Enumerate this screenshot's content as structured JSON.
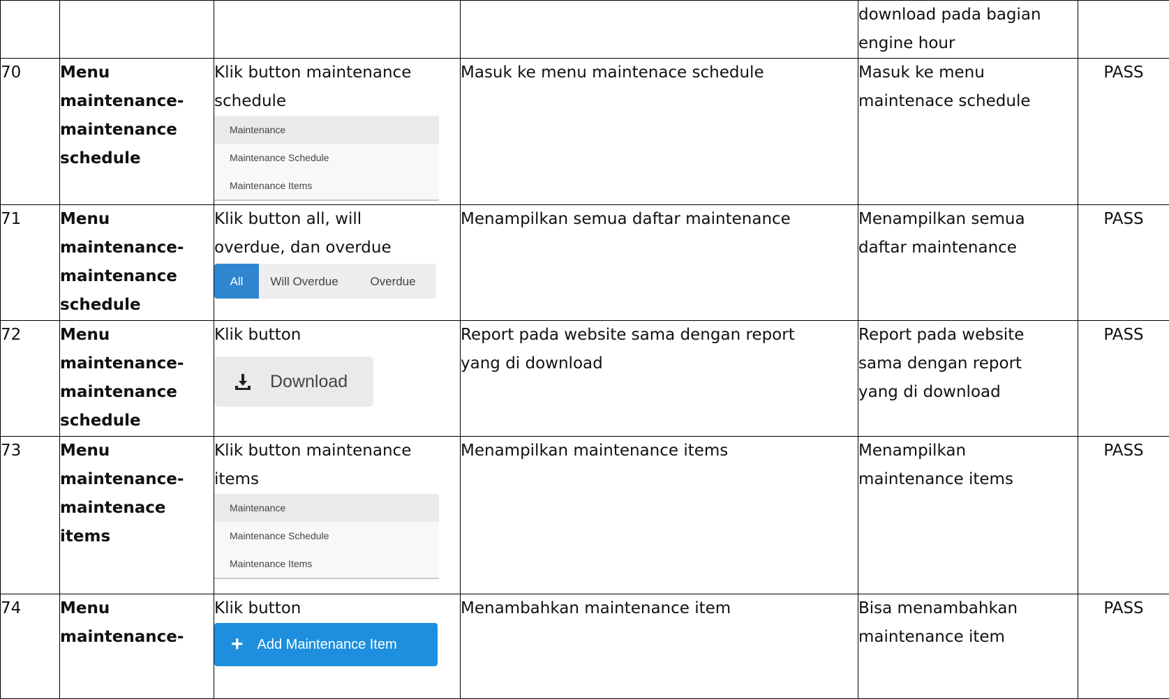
{
  "rows": [
    {
      "no": "",
      "menu": [],
      "step": [],
      "expected": [],
      "actual": [
        "download pada bagian",
        "engine hour"
      ],
      "result": ""
    },
    {
      "no": "70",
      "menu": [
        "Menu",
        "maintenance-",
        "maintenance",
        "schedule"
      ],
      "step": [
        "Klik button maintenance",
        "schedule"
      ],
      "step_widget": {
        "type": "menu",
        "items": [
          "Maintenance",
          "Maintenance Schedule",
          "Maintenance Items"
        ]
      },
      "expected": [
        "Masuk ke menu maintenace schedule"
      ],
      "actual": [
        "Masuk ke menu",
        "maintenace schedule"
      ],
      "result": "PASS"
    },
    {
      "no": "71",
      "menu": [
        "Menu",
        "maintenance-",
        "maintenance",
        "schedule"
      ],
      "step": [
        "Klik button all, will",
        "overdue, dan overdue"
      ],
      "step_widget": {
        "type": "segmented",
        "items": [
          "All",
          "Will Overdue",
          "Overdue"
        ],
        "active": "All"
      },
      "expected": [
        "Menampilkan semua daftar maintenance"
      ],
      "actual": [
        "Menampilkan semua",
        "daftar maintenance"
      ],
      "result": "PASS"
    },
    {
      "no": "72",
      "menu": [
        "Menu",
        "maintenance-",
        "maintenance",
        "schedule"
      ],
      "step": [
        "Klik button"
      ],
      "step_widget": {
        "type": "download",
        "label": "Download",
        "icon": "download-icon"
      },
      "expected": [
        "Report pada website sama dengan report",
        "yang di download"
      ],
      "actual": [
        "Report pada website",
        "sama dengan report",
        "yang di download"
      ],
      "result": "PASS"
    },
    {
      "no": "73",
      "menu": [
        "Menu",
        "maintenance-",
        "maintenace",
        "items"
      ],
      "step": [
        "Klik button maintenance",
        "items"
      ],
      "step_widget": {
        "type": "menu",
        "items": [
          "Maintenance",
          "Maintenance Schedule",
          "Maintenance Items"
        ]
      },
      "expected": [
        "Menampilkan maintenance items"
      ],
      "actual": [
        "Menampilkan",
        "maintenance items"
      ],
      "result": "PASS"
    },
    {
      "no": "74",
      "menu": [
        "Menu",
        "maintenance-"
      ],
      "step": [
        "Klik button"
      ],
      "step_widget": {
        "type": "add",
        "label": "Add Maintenance Item",
        "icon": "plus-icon",
        "color": "#1d8fde"
      },
      "expected": [
        "Menambahkan maintenance item"
      ],
      "actual": [
        "Bisa menambahkan",
        "maintenance item"
      ],
      "result": "PASS"
    }
  ]
}
